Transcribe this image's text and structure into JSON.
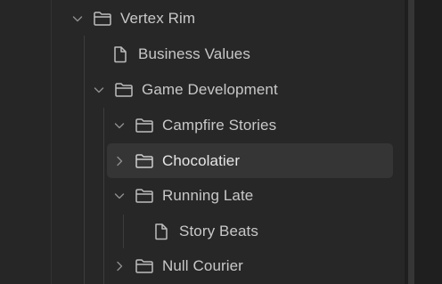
{
  "tree": {
    "items": [
      {
        "label": "Vertex Rim",
        "type": "folder",
        "expanded": true,
        "chevron_icon": "chevron-down-icon",
        "item_icon": "folder-icon"
      },
      {
        "label": "Business Values",
        "type": "file",
        "item_icon": "file-icon"
      },
      {
        "label": "Game Development",
        "type": "folder",
        "expanded": true,
        "chevron_icon": "chevron-down-icon",
        "item_icon": "folder-icon"
      },
      {
        "label": "Campfire Stories",
        "type": "folder",
        "expanded": true,
        "chevron_icon": "chevron-down-icon",
        "item_icon": "folder-icon"
      },
      {
        "label": "Chocolatier",
        "type": "folder",
        "expanded": false,
        "selected": true,
        "chevron_icon": "chevron-right-icon",
        "item_icon": "folder-icon"
      },
      {
        "label": "Running Late",
        "type": "folder",
        "expanded": true,
        "chevron_icon": "chevron-down-icon",
        "item_icon": "folder-icon"
      },
      {
        "label": "Story Beats",
        "type": "file",
        "item_icon": "file-icon"
      },
      {
        "label": "Null Courier",
        "type": "folder",
        "expanded": false,
        "chevron_icon": "chevron-right-icon",
        "item_icon": "folder-icon"
      }
    ]
  },
  "colors": {
    "background": "#272727",
    "text": "#c8c8c8",
    "selected_text": "#e6e6e6",
    "selected_bg": "#353535",
    "icon": "#bdbdbd",
    "chevron": "#8f8f8f",
    "guide": "#3d3d3d"
  }
}
